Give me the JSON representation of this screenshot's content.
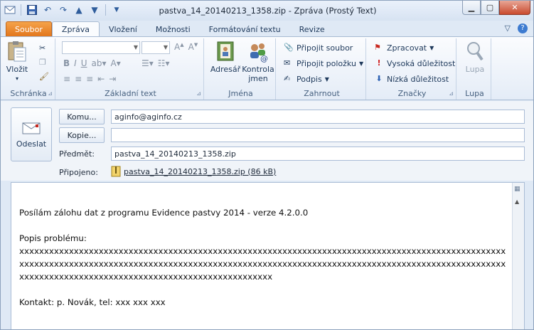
{
  "window": {
    "title": "pastva_14_20140213_1358.zip  -  Zpráva (Prostý Text)"
  },
  "tabs": [
    "Soubor",
    "Zpráva",
    "Vložení",
    "Možnosti",
    "Formátování textu",
    "Revize"
  ],
  "ribbon": {
    "clipboard": {
      "paste": "Vložit",
      "label": "Schránka"
    },
    "basic_text": {
      "label": "Základní text"
    },
    "names": {
      "address_book": "Adresář",
      "check_names_1": "Kontrola",
      "check_names_2": "jmen",
      "label": "Jména"
    },
    "include": {
      "attach_file": "Připojit soubor",
      "attach_item": "Připojit položku",
      "signature": "Podpis",
      "label": "Zahrnout"
    },
    "tags": {
      "follow_up": "Zpracovat",
      "high": "Vysoká důležitost",
      "low": "Nízká důležitost",
      "label": "Značky"
    },
    "zoom": {
      "zoom": "Lupa",
      "label": "Lupa"
    }
  },
  "compose": {
    "send": "Odeslat",
    "to_button": "Komu...",
    "to_value": "aginfo@aginfo.cz",
    "cc_button": "Kopie...",
    "cc_value": "",
    "subject_label": "Předmět:",
    "subject_value": "pastva_14_20140213_1358.zip",
    "attached_label": "Připojeno:",
    "attachment": "pastva_14_20140213_1358.zip (86 kB)"
  },
  "body": {
    "text": "Posílám zálohu dat z programu Evidence pastvy 2014 - verze 4.2.0.0\n\nPopis problému:\nxxxxxxxxxxxxxxxxxxxxxxxxxxxxxxxxxxxxxxxxxxxxxxxxxxxxxxxxxxxxxxxxxxxxxxxxxxxxxxxxxxxxxxxxxxxxxxxxxxxxxxxxxxxxxxxxxxxxxxxxxxxxxxxxxxxxxxxxxxxxxxxxxxxxxxxxxxxxxxxxxxxxxxxxxxxxxxxxxxxxxxxxxxxxxxxxxxxxxxxxxxxxxxxxxxxxxxxxxxxxxxxxxxxxxxxxxxxxxxxxxxxxxxx\n\nKontakt: p. Novák, tel: xxx xxx xxx"
  }
}
